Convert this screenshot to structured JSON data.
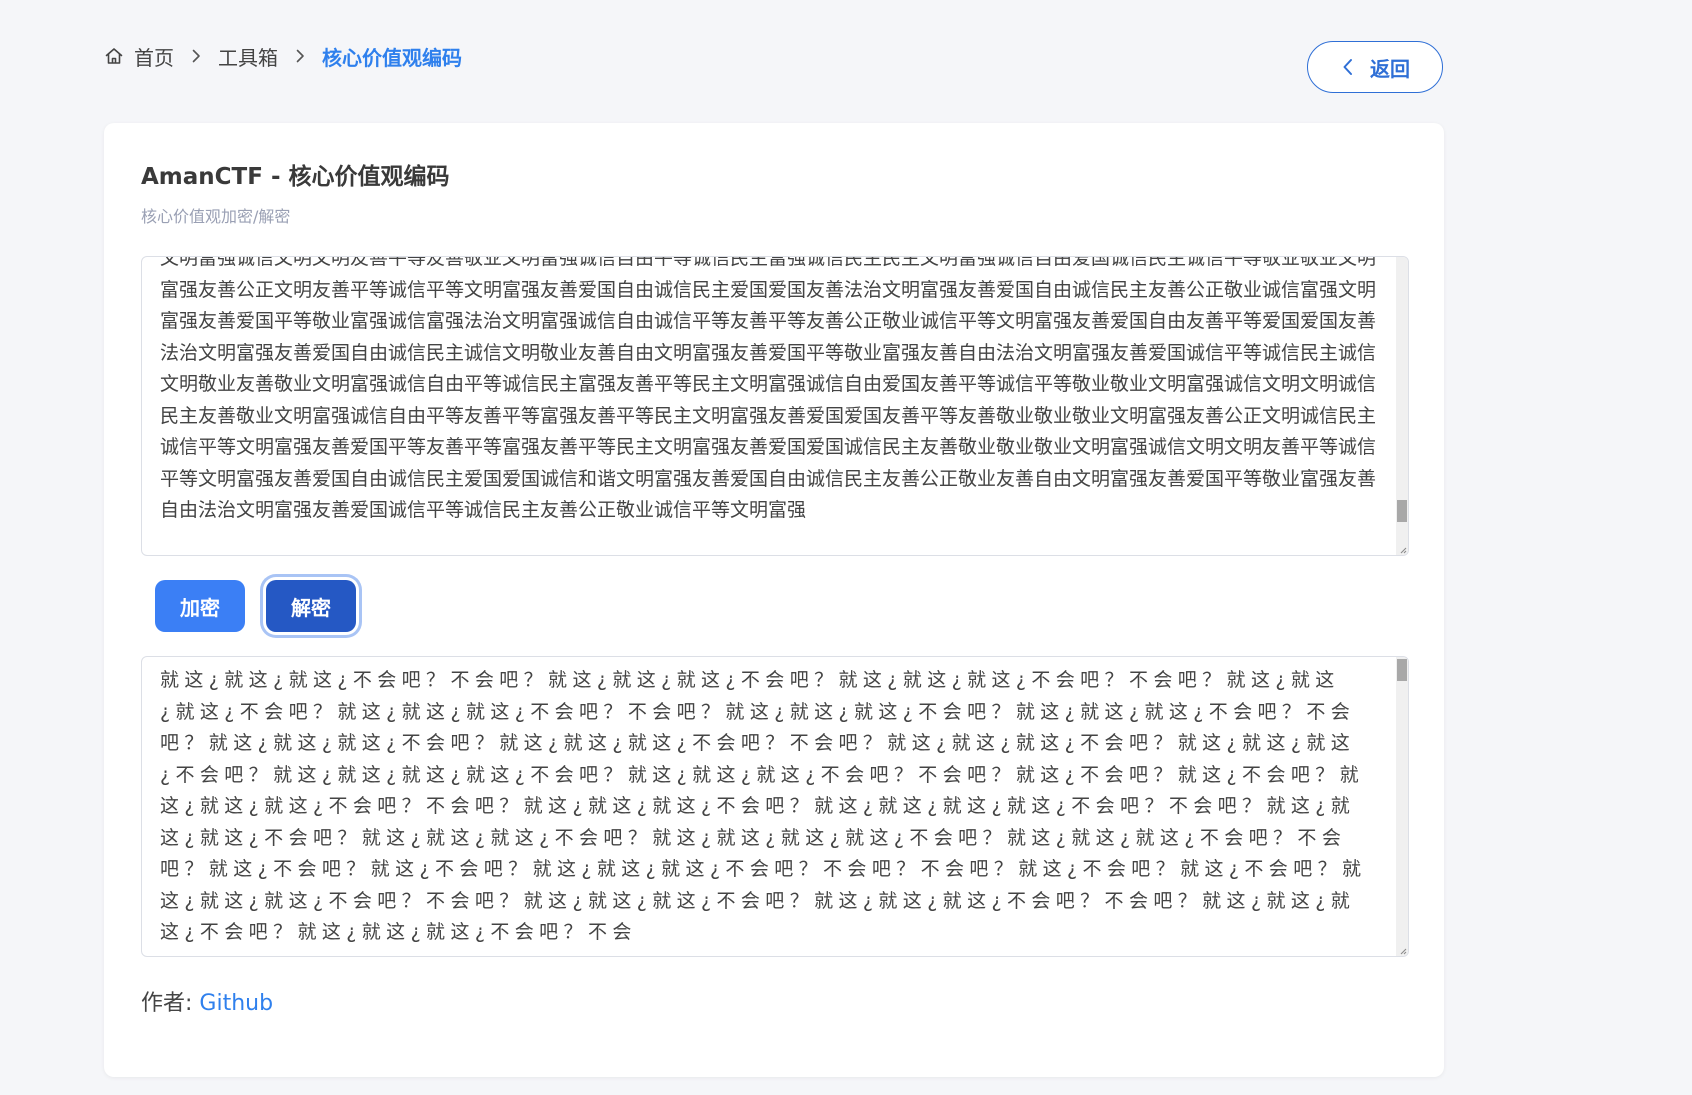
{
  "breadcrumb": {
    "home": "首页",
    "toolbox": "工具箱",
    "current": "核心价值观编码"
  },
  "back_button": {
    "label": "返回"
  },
  "card": {
    "title": "AmanCTF - 核心价值观编码",
    "subtitle": "核心价值观加密/解密"
  },
  "input": {
    "value": "文明富强诚信文明文明友善平等友善敬业文明富强诚信自由平等诚信民主富强诚信民主民主文明富强诚信自由爱国诚信民主诚信平等敬业敬业文明富强友善公正文明友善平等诚信平等文明富强友善爱国自由诚信民主爱国爱国友善法治文明富强友善爱国自由诚信民主友善公正敬业诚信富强文明富强友善爱国平等敬业富强诚信富强法治文明富强诚信自由诚信平等友善平等友善公正敬业诚信平等文明富强友善爱国自由友善平等爱国爱国友善法治文明富强友善爱国自由诚信民主诚信文明敬业友善自由文明富强友善爱国平等敬业富强友善自由法治文明富强友善爱国诚信平等诚信民主诚信文明敬业友善敬业文明富强诚信自由平等诚信民主富强友善平等民主文明富强诚信自由爱国友善平等诚信平等敬业敬业文明富强诚信文明文明诚信民主友善敬业文明富强诚信自由平等友善平等富强友善平等民主文明富强友善爱国爱国友善平等友善敬业敬业敬业文明富强友善公正文明诚信民主诚信平等文明富强友善爱国平等友善平等富强友善平等民主文明富强友善爱国爱国诚信民主友善敬业敬业敬业文明富强诚信文明文明友善平等诚信平等文明富强友善爱国自由诚信民主爱国爱国诚信和谐文明富强友善爱国自由诚信民主友善公正敬业友善自由文明富强友善爱国平等敬业富强友善自由法治文明富强友善爱国诚信平等诚信民主友善公正敬业诚信平等文明富强"
  },
  "buttons": {
    "encrypt": "加密",
    "decrypt": "解密"
  },
  "output": {
    "value": "就这¿就这¿就这¿不会吧？不会吧？就这¿就这¿就这¿不会吧？就这¿就这¿就这¿不会吧？不会吧？就这¿就这¿就这¿不会吧？就这¿就这¿就这¿不会吧？不会吧？就这¿就这¿就这¿不会吧？就这¿就这¿就这¿不会吧？不会吧？就这¿就这¿就这¿不会吧？就这¿就这¿就这¿不会吧？不会吧？就这¿就这¿就这¿不会吧？就这¿就这¿就这¿不会吧？就这¿就这¿就这¿就这¿不会吧？就这¿就这¿就这¿不会吧？不会吧？就这¿不会吧？就这¿不会吧？就这¿就这¿就这¿不会吧？不会吧？就这¿就这¿就这¿不会吧？就这¿就这¿就这¿就这¿不会吧？不会吧？就这¿就这¿就这¿不会吧？就这¿就这¿就这¿不会吧？就这¿就这¿就这¿就这¿不会吧？就这¿就这¿就这¿不会吧？不会吧？就这¿不会吧？就这¿不会吧？就这¿就这¿就这¿不会吧？不会吧？不会吧？就这¿不会吧？就这¿不会吧？就这¿就这¿就这¿不会吧？不会吧？就这¿就这¿就这¿不会吧？就这¿就这¿就这¿不会吧？不会吧？就这¿就这¿就这¿不会吧？就这¿就这¿就这¿不会吧？不会"
  },
  "author": {
    "label": "作者: ",
    "link_text": "Github"
  },
  "colors": {
    "accent": "#2f80ed",
    "encrypt_button": "#3b7ff5",
    "decrypt_button": "#2558c4",
    "background": "#f5f6f9"
  },
  "icons": {
    "home": "home-icon",
    "separator": "chevron-right-icon",
    "back": "chevron-left-icon"
  }
}
